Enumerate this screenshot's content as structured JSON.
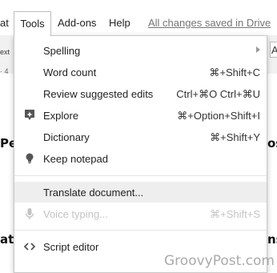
{
  "menubar": {
    "partial_label": "at",
    "tools_label": "Tools",
    "addons_label": "Add-ons",
    "help_label": "Help",
    "saved_status": "All changes saved in Drive"
  },
  "background": {
    "left_text": "ext",
    "ruler_text": "· 4",
    "big_left_1": "Pe",
    "big_right_1": "os",
    "big_left_2": "at",
    "big_right_2": "ns",
    "right_edge": "A"
  },
  "menu": {
    "items": [
      {
        "label": "Spelling",
        "shortcut": "",
        "icon": "",
        "has_submenu": true,
        "disabled": false
      },
      {
        "label": "Word count",
        "shortcut": "⌘+Shift+C",
        "icon": "",
        "has_submenu": false,
        "disabled": false
      },
      {
        "label": "Review suggested edits",
        "shortcut": "Ctrl+⌘O Ctrl+⌘U",
        "icon": "",
        "has_submenu": false,
        "disabled": false
      },
      {
        "label": "Explore",
        "shortcut": "⌘+Option+Shift+I",
        "icon": "explore-icon",
        "has_submenu": false,
        "disabled": false
      },
      {
        "label": "Dictionary",
        "shortcut": "⌘+Shift+Y",
        "icon": "",
        "has_submenu": false,
        "disabled": false
      },
      {
        "label": "Keep notepad",
        "shortcut": "",
        "icon": "lightbulb-icon",
        "has_submenu": false,
        "disabled": false
      },
      {
        "label": "Translate document...",
        "shortcut": "",
        "icon": "",
        "has_submenu": false,
        "disabled": false,
        "highlighted": true
      },
      {
        "label": "Voice typing...",
        "shortcut": "⌘+Shift+S",
        "icon": "microphone-icon",
        "has_submenu": false,
        "disabled": true
      },
      {
        "label": "Script editor",
        "shortcut": "",
        "icon": "code-icon",
        "has_submenu": false,
        "disabled": false
      }
    ]
  },
  "watermark": "GroovyPost.com",
  "colors": {
    "menu_bg": "#ffffff",
    "highlight_bg": "#eeeeee",
    "disabled_text": "#c3c3c3",
    "saved_status": "#757575"
  }
}
